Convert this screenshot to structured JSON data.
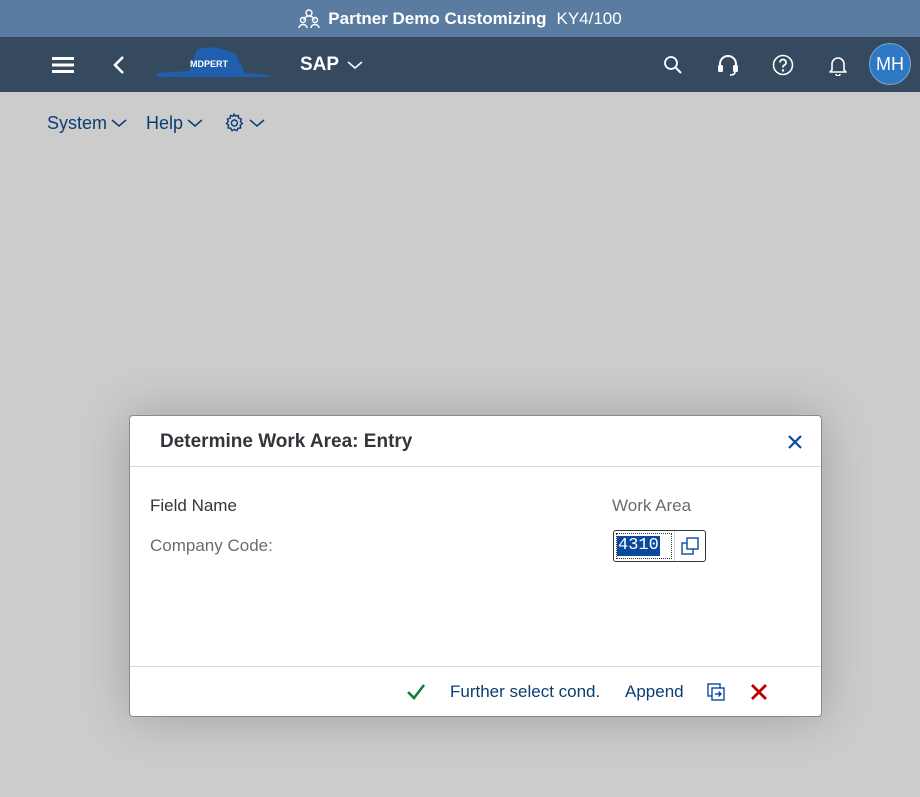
{
  "window": {
    "title": "Partner Demo Customizing",
    "system": "KY4/100"
  },
  "shell": {
    "logo_text": "MDPERT",
    "app_title": "SAP",
    "user_initials": "MH"
  },
  "menu": {
    "system": "System",
    "help": "Help"
  },
  "dialog": {
    "title": "Determine Work Area: Entry",
    "header_field_name": "Field Name",
    "header_work_area": "Work Area",
    "company_code_label": "Company Code:",
    "company_code_value": "4310",
    "further_select": "Further select cond.",
    "append": "Append"
  },
  "colors": {
    "title_bar": "#5b7ca1",
    "shell_bar": "#354a5f",
    "link": "#0a3d73",
    "confirm": "#107e3e",
    "cancel": "#bb0000",
    "selection": "#0a4a9e"
  }
}
